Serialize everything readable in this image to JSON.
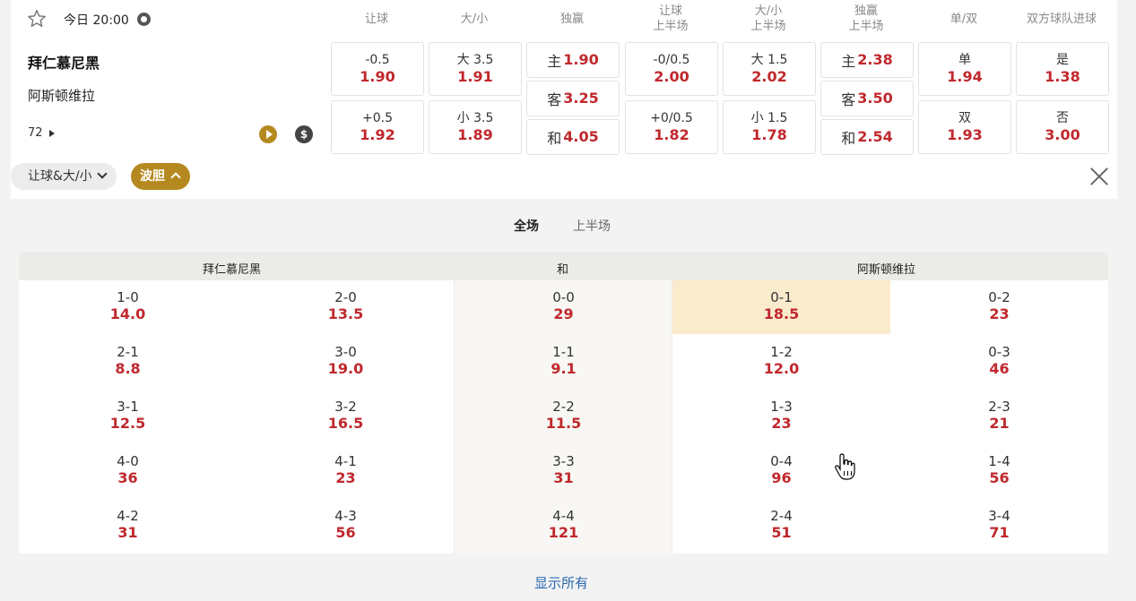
{
  "match": {
    "kickoff": "今日 20:00",
    "home": "拜仁慕尼黑",
    "away": "阿斯顿维拉",
    "more_count": "72"
  },
  "columns": [
    {
      "l1": "让球",
      "l2": ""
    },
    {
      "l1": "大/小",
      "l2": ""
    },
    {
      "l1": "独赢",
      "l2": ""
    },
    {
      "l1": "让球",
      "l2": "上半场"
    },
    {
      "l1": "大/小",
      "l2": "上半场"
    },
    {
      "l1": "独赢",
      "l2": "上半场"
    },
    {
      "l1": "单/双",
      "l2": ""
    },
    {
      "l1": "双方球队进球",
      "l2": ""
    }
  ],
  "markets": {
    "handicap": [
      {
        "line": "-0.5",
        "odd": "1.90"
      },
      {
        "line": "+0.5",
        "odd": "1.92"
      }
    ],
    "total": [
      {
        "line": "大 3.5",
        "odd": "1.91"
      },
      {
        "line": "小 3.5",
        "odd": "1.89"
      }
    ],
    "moneyline": [
      {
        "label": "主",
        "odd": "1.90"
      },
      {
        "label": "客",
        "odd": "3.25"
      },
      {
        "label": "和",
        "odd": "4.05"
      }
    ],
    "handicap_1h": [
      {
        "line": "-0/0.5",
        "odd": "2.00"
      },
      {
        "line": "+0/0.5",
        "odd": "1.82"
      }
    ],
    "total_1h": [
      {
        "line": "大 1.5",
        "odd": "2.02"
      },
      {
        "line": "小 1.5",
        "odd": "1.78"
      }
    ],
    "moneyline_1h": [
      {
        "label": "主",
        "odd": "2.38"
      },
      {
        "label": "客",
        "odd": "3.50"
      },
      {
        "label": "和",
        "odd": "2.54"
      }
    ],
    "odd_even": [
      {
        "line": "单",
        "odd": "1.94"
      },
      {
        "line": "双",
        "odd": "1.93"
      }
    ],
    "btts": [
      {
        "line": "是",
        "odd": "1.38"
      },
      {
        "line": "否",
        "odd": "3.00"
      }
    ]
  },
  "pills": {
    "handicap_total": "让球&大/小",
    "correct_score": "波胆"
  },
  "period_tabs": {
    "full": "全场",
    "first_half": "上半场"
  },
  "correct_score": {
    "headers": {
      "home": "拜仁慕尼黑",
      "draw": "和",
      "away": "阿斯顿维拉"
    },
    "rows": [
      [
        {
          "s": "1-0",
          "o": "14.0"
        },
        {
          "s": "2-0",
          "o": "13.5"
        },
        {
          "s": "0-0",
          "o": "29"
        },
        {
          "s": "0-1",
          "o": "18.5"
        },
        {
          "s": "0-2",
          "o": "23"
        }
      ],
      [
        {
          "s": "2-1",
          "o": "8.8"
        },
        {
          "s": "3-0",
          "o": "19.0"
        },
        {
          "s": "1-1",
          "o": "9.1"
        },
        {
          "s": "1-2",
          "o": "12.0"
        },
        {
          "s": "0-3",
          "o": "46"
        }
      ],
      [
        {
          "s": "3-1",
          "o": "12.5"
        },
        {
          "s": "3-2",
          "o": "16.5"
        },
        {
          "s": "2-2",
          "o": "11.5"
        },
        {
          "s": "1-3",
          "o": "23"
        },
        {
          "s": "2-3",
          "o": "21"
        }
      ],
      [
        {
          "s": "4-0",
          "o": "36"
        },
        {
          "s": "4-1",
          "o": "23"
        },
        {
          "s": "3-3",
          "o": "31"
        },
        {
          "s": "0-4",
          "o": "96"
        },
        {
          "s": "1-4",
          "o": "56"
        }
      ],
      [
        {
          "s": "4-2",
          "o": "31"
        },
        {
          "s": "4-3",
          "o": "56"
        },
        {
          "s": "4-4",
          "o": "121"
        },
        {
          "s": "2-4",
          "o": "51"
        },
        {
          "s": "3-4",
          "o": "71"
        }
      ]
    ]
  },
  "show_all": "显示所有",
  "colors": {
    "accent": "#b5891f",
    "price": "#c0282d",
    "highlight": "#faebcc",
    "link": "#2a68b0"
  }
}
